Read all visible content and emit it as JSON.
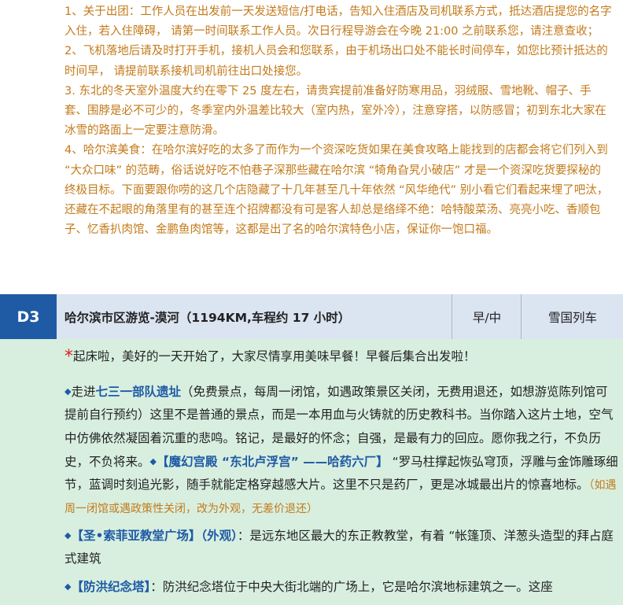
{
  "notes": [
    "1、关于出团：工作人员在出发前一天发送短信/打电话，告知入住酒店及司机联系方式，抵达酒店提您的名字入住，若入住障碍， 请第一时间联系工作人员。次日行程导游会在今晚 21:00 之前联系您，请注意查收；",
    "2、飞机落地后请及时打开手机，接机人员会和您联系，由于机场出口处不能长时间停车，如您比预计抵达的时间早， 请提前联系接机司机前往出口处接您。",
    "3. 东北的冬天室外温度大约在零下 25 度左右，请贵宾提前准备好防寒用品，羽绒服、雪地靴、帽子、手套、围脖是必不可少的，冬季室内外温差比较大（室内热，室外冷），注意穿搭，以防感冒；初到东北大家在冰雪的路面上一定要注意防滑。",
    "4、哈尔滨美食：在哈尔滨好吃的太多了而作为一个资深吃货如果在美食攻略上能找到的店都会将它们列入到 “大众口味” 的范畴，俗话说好吃不怕巷子深那些藏在哈尔滨 “犄角旮旯小破店” 才是一个资深吃货要探秘的终极目标。下面要跟你唠的这几个店隐藏了十几年甚至几十年依然 “风华绝代” 别小看它们看起来埋了吧汰，还藏在不起眼的角落里有的甚至连个招牌都没有可是客人却总是络绎不绝：哈特酸菜汤、亮亮小吃、香顺包子、忆香扒肉馆、金鹏鱼肉馆等，这都是出了名的哈尔滨特色小店，保证你一饱口福。"
  ],
  "day": {
    "label": "D3",
    "title": "哈尔滨市区游览-漠河（1194KM,车程约 17 小时）",
    "meals": "早/中",
    "hotel": "雪国列车"
  },
  "content": {
    "star": "*",
    "intro": "起床啦，美好的一天开始了，大家尽情享用美味早餐！早餐后集合出发啦！",
    "diamond": "◆",
    "p1_a": "走进",
    "p1_b": "七三一部队遗址",
    "p1_c": "（免费景点，每周一闭馆，如遇政策景区关闭，无费用退还，如想游览陈列馆可提前自行预约）这里不是普通的景点，而是一本用血与火铸就的历史教科书。当你踏入这片土地，空气中仿佛依然凝固着沉重的悲鸣。铭记，是最好的怀念；自强，是最有力的回应。愿你我之行，不负历史，不负将来。",
    "p1_d": "【魔幻宫殿 “东北卢浮宫” ——哈药六厂】",
    "p1_e": " “罗马柱撑起恢弘穹顶，浮雕与金饰雕琢细节，蓝调时刻追光影，随手就能定格穿越感大片。这里不只是药厂，更是冰城最出片的惊喜地标。",
    "p1_f": "（如遇周一闭馆或遇政策性关闭，改为外观，无差价退还）",
    "p2_a": "【圣•索菲亚教堂广场】（外观）",
    "p2_b": "：是远东地区最大的东正教教堂，有着 “帐篷顶、洋葱头造型的拜占庭式建筑",
    "p3_a": "【防洪纪念塔】",
    "p3_b": "：防洪纪念塔位于中央大街北端的广场上，它是哈尔滨地标建筑之一。这座"
  },
  "colors": {
    "orange_text": "#c37a1a",
    "blue_accent": "#1f5aa4",
    "header_bg": "#dbe4f1",
    "content_bg": "#d8efe0",
    "star_red": "#d92020"
  }
}
